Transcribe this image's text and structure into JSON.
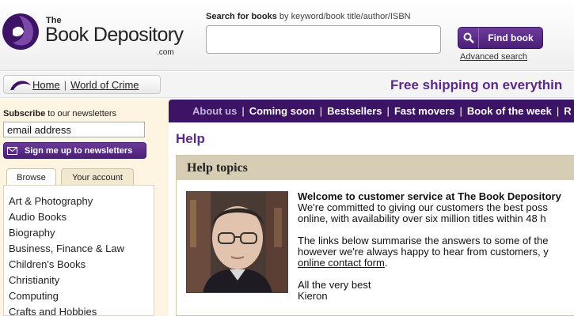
{
  "header": {
    "logo": {
      "the": "The",
      "name": "Book Depository",
      "com": ".com"
    },
    "search": {
      "label_bold": "Search for books",
      "label_rest": " by keyword/book title/author/ISBN",
      "value": "",
      "button_label": "Find book",
      "advanced_link": "Advanced search"
    }
  },
  "breadcrumb": {
    "home": "Home",
    "separator": "|",
    "current": "World of Crime"
  },
  "promo": {
    "free_shipping": "Free shipping on everythin"
  },
  "sidebar": {
    "subscribe_bold": "Subscribe",
    "subscribe_rest": " to our newsletters",
    "email_value": "email address",
    "signup_button": "Sign me up to newsletters",
    "tabs": [
      "Browse",
      "Your account"
    ],
    "categories": [
      "Art & Photography",
      "Audio Books",
      "Biography",
      "Business, Finance & Law",
      "Children's Books",
      "Christianity",
      "Computing",
      "Crafts and Hobbies"
    ]
  },
  "nav": {
    "items": [
      "About us",
      "Coming soon",
      "Bestsellers",
      "Fast movers",
      "Book of the week",
      "R"
    ],
    "separator": "|"
  },
  "main": {
    "page_title": "Help",
    "panel_title": "Help topics",
    "welcome_heading": "Welcome to customer service at The Book Depository",
    "para1_line1": "We're committed to giving our customers the best poss",
    "para1_line2": "online, with availability over six million titles within 48 h",
    "para2_line1": "The links below summarise the answers to some of the",
    "para2_line2": "however we're always happy to hear from customers, y",
    "contact_link": "online contact form",
    "contact_after": ".",
    "signoff": "All the very best",
    "signature": "Kieron"
  },
  "colors": {
    "brand_purple": "#5a2a86",
    "nav_bg": "#3d1465",
    "sidebar_bg": "#fdf4e2",
    "panel_head": "#d6cdb4"
  }
}
